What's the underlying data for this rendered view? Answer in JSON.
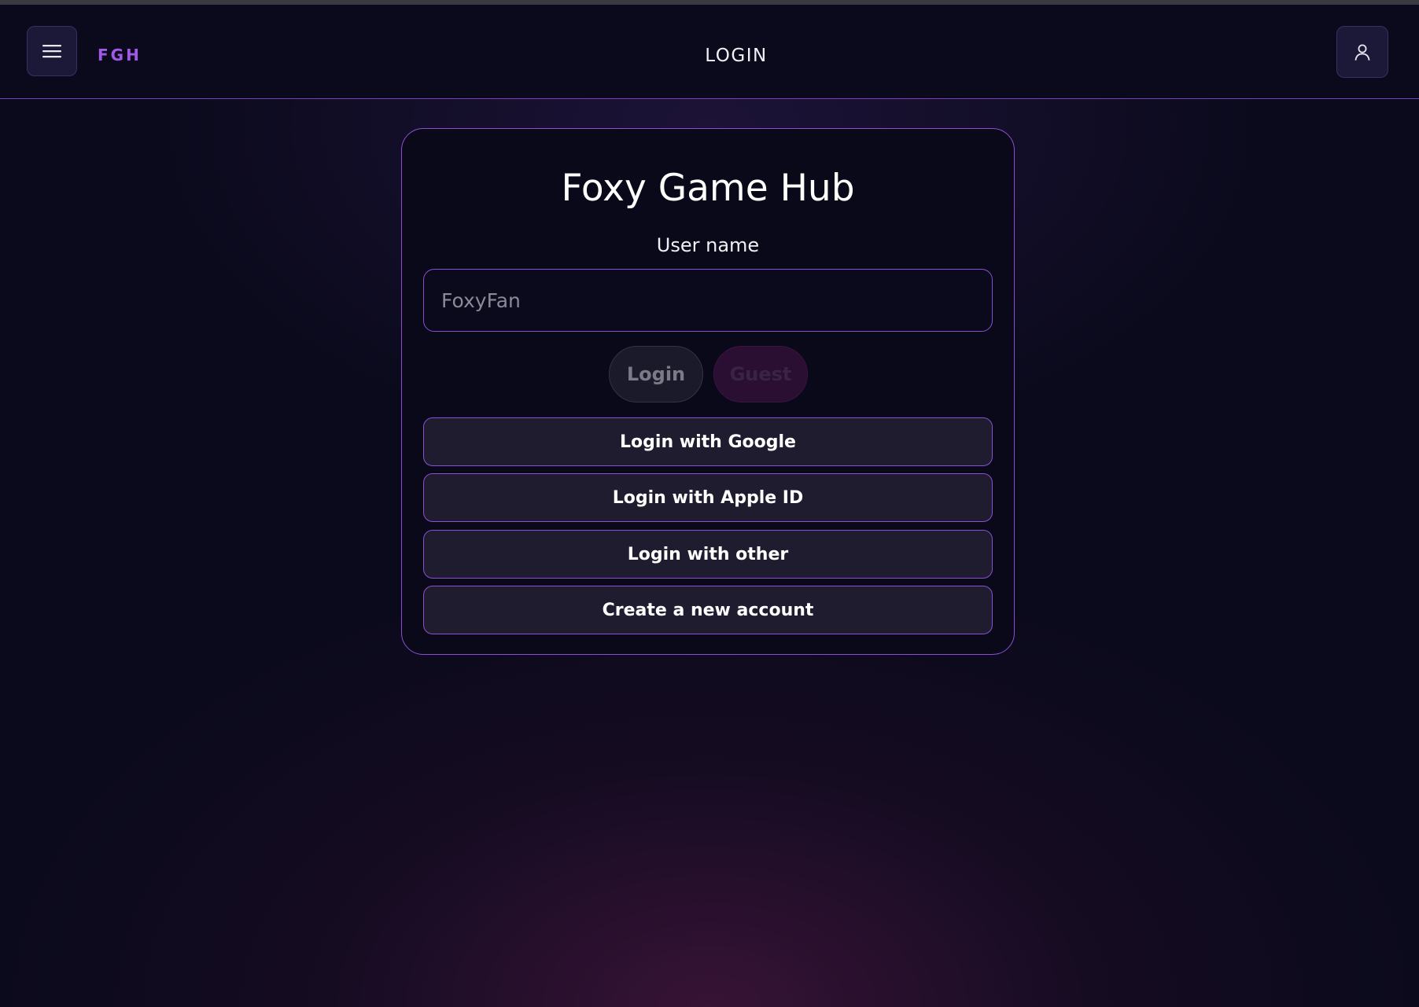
{
  "header": {
    "brand": "FGH",
    "title": "LOGIN",
    "menu_icon": "hamburger-menu-icon",
    "user_icon": "user-icon"
  },
  "card": {
    "title": "Foxy Game Hub",
    "username_label": "User name",
    "username_placeholder": "FoxyFan",
    "username_value": "",
    "login_button": "Login",
    "guest_button": "Guest",
    "google_button": "Login with Google",
    "apple_button": "Login with Apple ID",
    "other_button": "Login with other",
    "create_button": "Create a new account"
  },
  "colors": {
    "accent": "#8c4fd4",
    "brand": "#a159e6",
    "background": "#0b0a1c"
  }
}
